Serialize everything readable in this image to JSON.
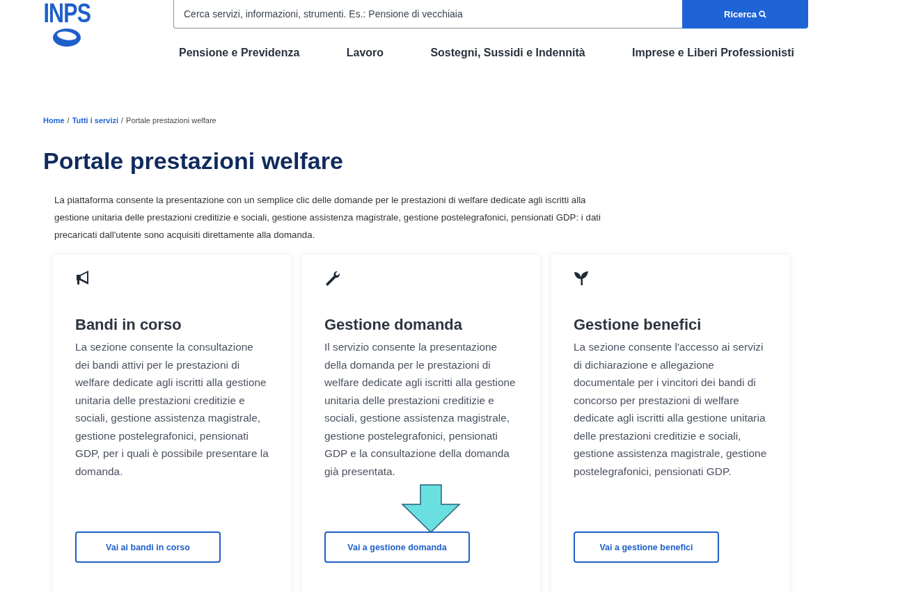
{
  "header": {
    "logo": "INPS",
    "search": {
      "placeholder": "Cerca servizi, informazioni, strumenti. Es.: Pensione di vecchiaia",
      "button": "Ricerca"
    },
    "nav": [
      "Pensione e Previdenza",
      "Lavoro",
      "Sostegni, Sussidi e Indennità",
      "Imprese e Liberi Professionisti"
    ]
  },
  "breadcrumb": [
    {
      "label": "Home",
      "link": true,
      "separator": "/"
    },
    {
      "label": "Tutti i servizi",
      "link": true,
      "separator": "/"
    },
    {
      "label": "Portale prestazioni welfare",
      "link": false
    }
  ],
  "title": "Portale prestazioni welfare",
  "intro": "La piattaforma consente la presentazione con un semplice clic delle domande per le prestazioni di welfare dedicate agli iscritti alla gestione unitaria delle prestazioni creditizie e sociali, gestione assistenza magistrale, gestione postelegrafonici, pensionati GDP: i dati precaricati dall'utente sono acquisiti direttamente alla domanda.",
  "cards": [
    {
      "kind": "announcement",
      "title": "Bandi in corso",
      "text": "La sezione consente la consultazione dei bandi attivi per le prestazioni di welfare dedicate agli iscritti alla gestione unitaria delle prestazioni creditizie e sociali, gestione assistenza magistrale, gestione postelegrafonici, pensionati GDP, per i quali è possibile presentare la domanda.",
      "button": "Vai ai bandi in corso",
      "highlighted": false
    },
    {
      "kind": "tool",
      "title": "Gestione domanda",
      "text": "Il servizio consente la presentazione della domanda per le prestazioni di welfare dedicate agli iscritti alla gestione unitaria delle prestazioni creditizie e sociali, gestione assistenza magistrale, gestione postelegrafonici, pensionati GDP e la consultazione della domanda già presentata.",
      "button": "Vai a gestione domanda",
      "highlighted": true
    },
    {
      "kind": "growth",
      "title": "Gestione benefici",
      "text": "La sezione consente l'accesso ai servizi di dichiarazione e allegazione documentale per i vincitori dei bandi di concorso per prestazioni di welfare dedicate agli iscritti alla gestione unitaria delle prestazioni creditizie e sociali, gestione assistenza magistrale, gestione postelegrafonici, pensionati GDP.",
      "button": "Vai a gestione benefici",
      "highlighted": false
    }
  ]
}
